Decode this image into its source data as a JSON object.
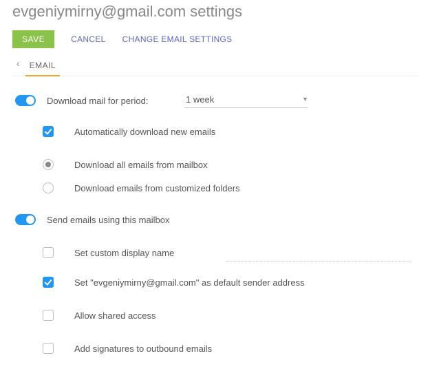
{
  "title": "evgeniymirny@gmail.com settings",
  "actions": {
    "save": "SAVE",
    "cancel": "CANCEL",
    "change_email": "CHANGE EMAIL SETTINGS"
  },
  "tab": {
    "email": "EMAIL"
  },
  "download": {
    "toggle_label": "Download mail for period:",
    "period_value": "1 week",
    "auto_label": "Automatically download new emails",
    "radio_all": "Download all emails from mailbox",
    "radio_custom": "Download emails from customized folders"
  },
  "send": {
    "toggle_label": "Send emails using this mailbox",
    "custom_name": "Set custom display name",
    "default_sender": "Set \"evgeniymirny@gmail.com\" as default sender address",
    "shared": "Allow shared access",
    "signatures": "Add signatures to outbound emails"
  }
}
